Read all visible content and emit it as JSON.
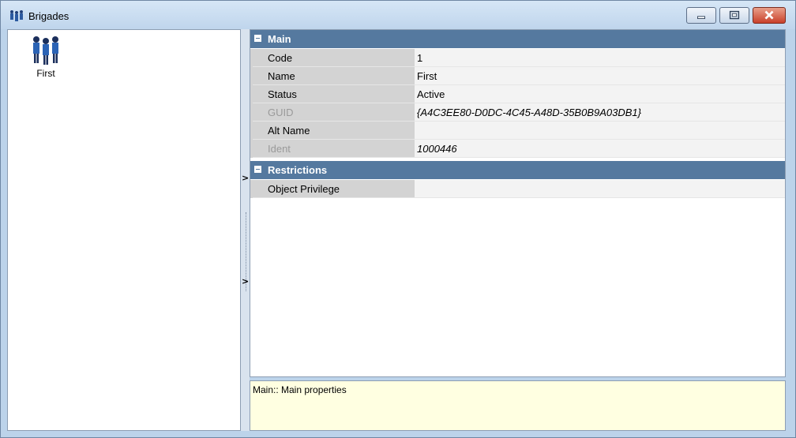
{
  "window": {
    "title": "Brigades",
    "title_icon": "people-group-icon",
    "buttons": {
      "minimize": "minimize-icon",
      "maximize": "maximize-icon",
      "close": "close-icon"
    }
  },
  "list": {
    "items": [
      {
        "label": "First",
        "icon": "people-group-icon"
      }
    ]
  },
  "splitter": {
    "arrow": ">"
  },
  "grid": {
    "categories": [
      {
        "label": "Main",
        "rows": [
          {
            "name": "Code",
            "value": "1"
          },
          {
            "name": "Name",
            "value": "First"
          },
          {
            "name": "Status",
            "value": "Active"
          },
          {
            "name": "GUID",
            "value": "{A4C3EE80-D0DC-4C45-A48D-35B0B9A03DB1}"
          },
          {
            "name": "Alt Name",
            "value": ""
          },
          {
            "name": "Ident",
            "value": "1000446"
          }
        ]
      },
      {
        "label": "Restrictions",
        "rows": [
          {
            "name": "Object Privilege",
            "value": ""
          }
        ]
      }
    ]
  },
  "description": {
    "text": "Main:: Main properties"
  },
  "colors": {
    "category_header": "#55799f",
    "name_cell": "#d3d3d3",
    "value_cell": "#f3f3f3",
    "description_bg": "#ffffe1",
    "window_frame": "#bcd3ea"
  }
}
